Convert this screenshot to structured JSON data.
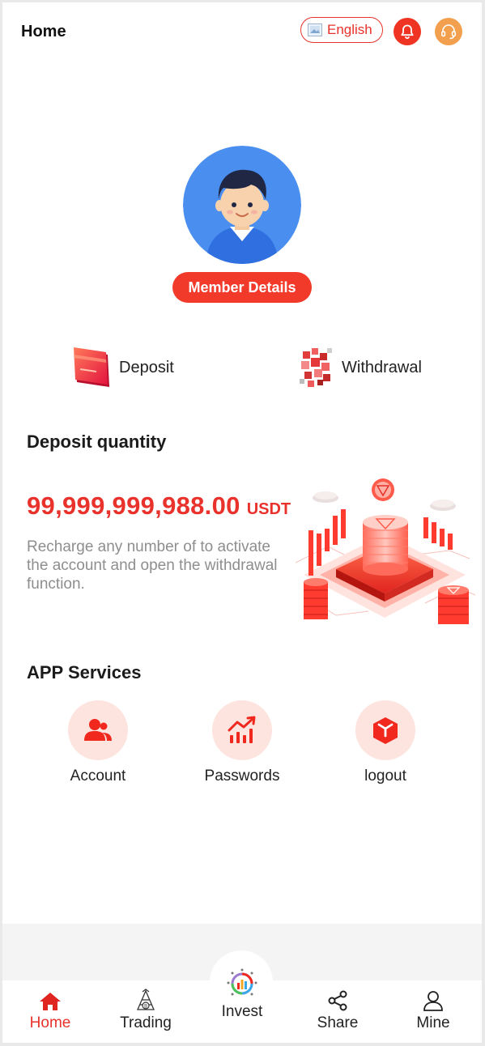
{
  "header": {
    "title": "Home",
    "language_label": "English",
    "icons": [
      "flag-image-icon",
      "bell-icon",
      "headset-icon"
    ]
  },
  "profile": {
    "member_details_label": "Member Details"
  },
  "actions": {
    "deposit_label": "Deposit",
    "withdrawal_label": "Withdrawal"
  },
  "deposit_quantity": {
    "title": "Deposit quantity",
    "amount": "99,999,999,988.00",
    "unit": "USDT",
    "description": "Recharge any number of to activate the account and open the withdrawal function."
  },
  "services": {
    "title": "APP Services",
    "items": [
      {
        "label": "Account",
        "icon": "user-group-icon"
      },
      {
        "label": "Passwords",
        "icon": "chart-trend-icon"
      },
      {
        "label": "logout",
        "icon": "box-icon"
      }
    ]
  },
  "tabbar": {
    "items": [
      {
        "label": "Home",
        "icon": "home-icon",
        "active": true
      },
      {
        "label": "Trading",
        "icon": "trading-icon",
        "active": false
      },
      {
        "label": "Invest",
        "icon": "invest-icon",
        "active": false
      },
      {
        "label": "Share",
        "icon": "share-icon",
        "active": false
      },
      {
        "label": "Mine",
        "icon": "person-icon",
        "active": false
      }
    ]
  },
  "colors": {
    "accent": "#e8322b",
    "avatar_bg": "#4a8ff0",
    "support": "#f2a04d",
    "service_bg": "#fde4df"
  }
}
